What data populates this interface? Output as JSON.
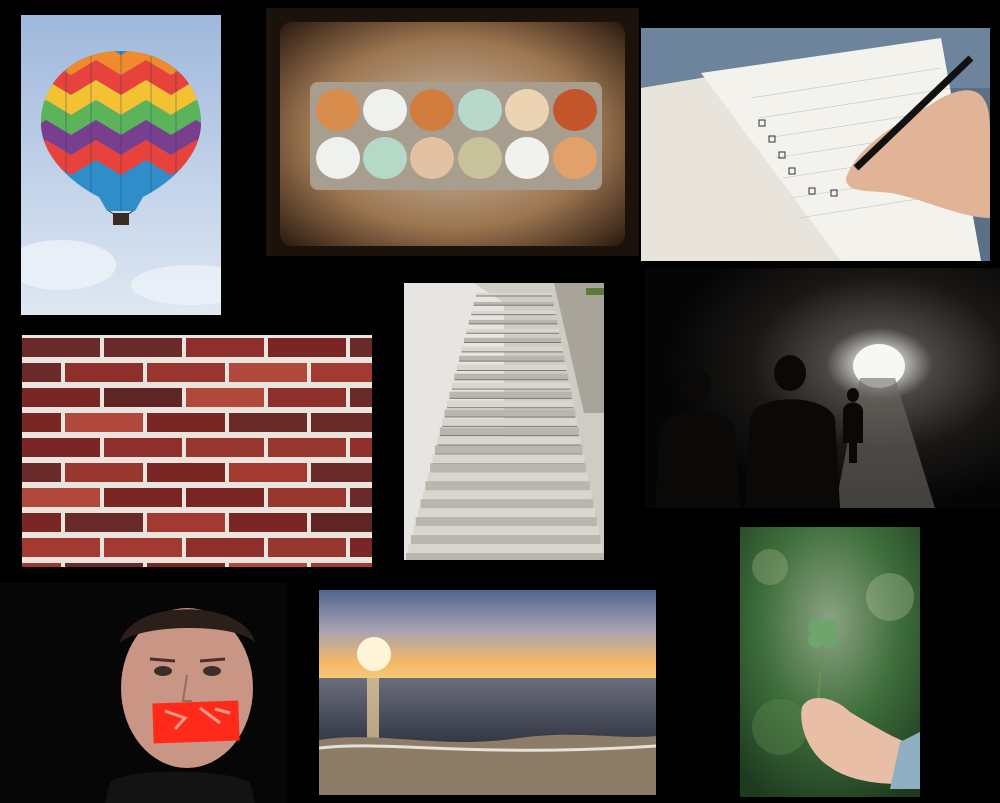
{
  "collage": {
    "background": "#000000",
    "tiles": [
      {
        "id": "balloon",
        "subject": "hot-air-balloon"
      },
      {
        "id": "eggs",
        "subject": "egg-carton"
      },
      {
        "id": "notebook",
        "subject": "checklist-notebook"
      },
      {
        "id": "bricks",
        "subject": "brick-wall"
      },
      {
        "id": "stairs",
        "subject": "stone-stairs"
      },
      {
        "id": "tunnel",
        "subject": "tunnel-silhouettes"
      },
      {
        "id": "clover",
        "subject": "four-leaf-clover"
      },
      {
        "id": "tape",
        "subject": "taped-mouth-portrait"
      },
      {
        "id": "beach",
        "subject": "beach-sunset"
      }
    ]
  },
  "colors": {
    "sky": "#b9cde8",
    "brick": "#8e2f2b",
    "mortar": "#e9e4de",
    "tape": "#ff2a1a",
    "sunset": "#f4b766",
    "foliage": "#3f6f3c"
  }
}
